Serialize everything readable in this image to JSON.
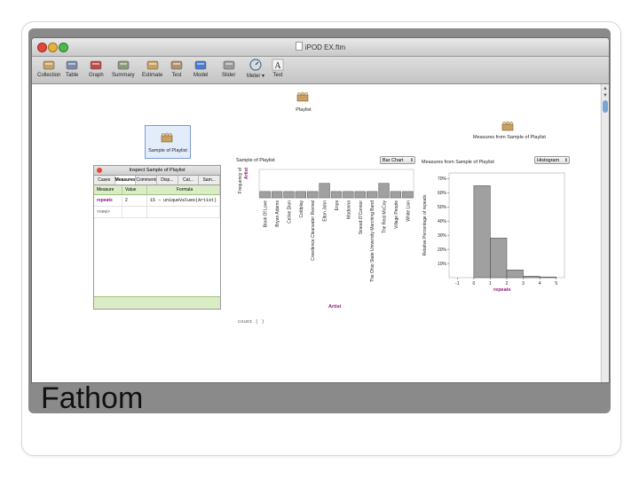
{
  "slide": {
    "caption": "Fathom"
  },
  "window": {
    "title": "iPOD EX.ftm"
  },
  "toolbar": {
    "items": [
      {
        "label": "Collection",
        "icon": "collection-icon"
      },
      {
        "label": "Table",
        "icon": "table-icon"
      },
      {
        "label": "Graph",
        "icon": "graph-icon"
      },
      {
        "label": "Summary",
        "icon": "summary-icon"
      },
      {
        "label": "Estimate",
        "icon": "estimate-icon"
      },
      {
        "label": "Test",
        "icon": "test-icon"
      },
      {
        "label": "Model",
        "icon": "model-icon"
      },
      {
        "label": "Slider",
        "icon": "slider-icon"
      },
      {
        "label": "Meter ▾",
        "icon": "meter-icon"
      },
      {
        "label": "Text",
        "icon": "text-icon"
      }
    ]
  },
  "canvas": {
    "playlist_label": "Playlist",
    "sample_label": "Sample of Playlist",
    "measures_label": "Measures from Sample of Playlist"
  },
  "inspector": {
    "title": "Inspect Sample of Playlist",
    "tabs": [
      "Cases",
      "Measures",
      "Comments",
      "Disp...",
      "Cat...",
      "Sam..."
    ],
    "active_tab": "Measures",
    "headers": [
      "Measure",
      "Value",
      "Formula"
    ],
    "rows": [
      {
        "measure": "repeats",
        "value": "2",
        "formula": "15 − uniqueValues(Artist)"
      },
      {
        "measure": "<new>",
        "value": "",
        "formula": ""
      }
    ]
  },
  "bar_graph": {
    "title": "Sample of Playlist",
    "dropdown": "Bar Chart",
    "xlabel": "Artist",
    "ylabel_a": "Frequency of",
    "ylabel_b": "Artist",
    "footer": "count (  )",
    "colors": {
      "bar": "#a0a0a0",
      "axis_label": "#8b1a7a"
    }
  },
  "histogram_graph": {
    "title": "Measures from Sample of Playlist",
    "dropdown": "Histogram",
    "footer_label": "repeats"
  },
  "chart_data": [
    {
      "type": "bar",
      "title": "",
      "xlabel": "Artist",
      "ylabel": "Frequency of Artist",
      "categories": [
        "Book Of Love",
        "Bryan Adams",
        "Celine Dion",
        "Coldplay",
        "Creedence Clearwater Revival",
        "Elton John",
        "Enya",
        "Madonna",
        "Sinead O'Connor",
        "The Ohio State University Marching Band",
        "The Real McCoy",
        "Village People",
        "White Lion"
      ],
      "values": [
        1,
        1,
        1,
        1,
        1,
        2,
        1,
        1,
        1,
        1,
        2,
        1,
        1
      ],
      "ylim": [
        0,
        2
      ]
    },
    {
      "type": "bar",
      "title": "",
      "xlabel": "repeats",
      "ylabel": "Relative Percentage of repeats",
      "x_ticks": [
        -1,
        0,
        1,
        2,
        3,
        4,
        5
      ],
      "y_ticks": [
        "10%",
        "20%",
        "30%",
        "40%",
        "50%",
        "60%",
        "70%"
      ],
      "bins": [
        [
          0,
          1
        ],
        [
          1,
          2
        ],
        [
          2,
          3
        ],
        [
          3,
          4
        ],
        [
          4,
          5
        ]
      ],
      "values": [
        65,
        28,
        5.5,
        1,
        0.5
      ],
      "ylim": [
        0,
        74
      ]
    }
  ]
}
